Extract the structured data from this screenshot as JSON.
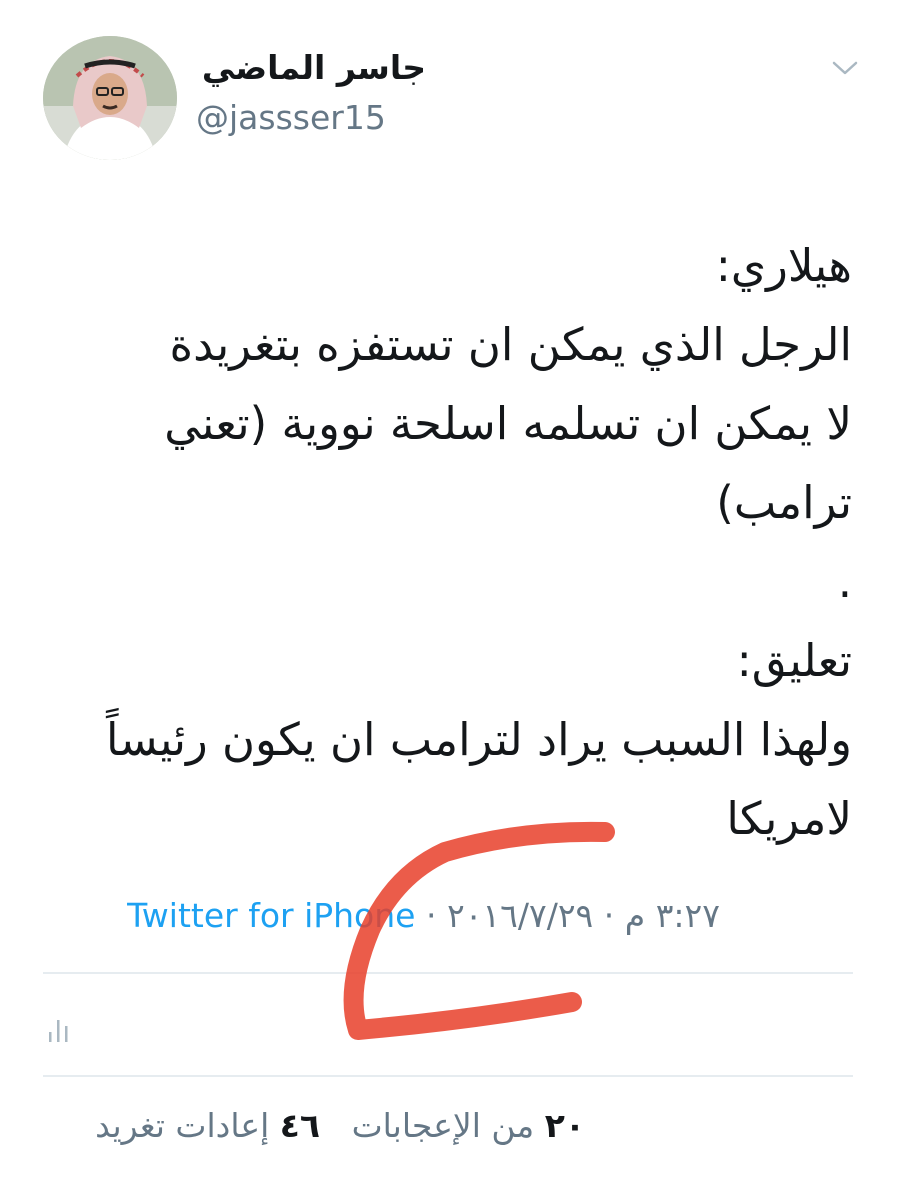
{
  "user": {
    "display_name": "جاسر الماضي",
    "handle": "@jassser15"
  },
  "tweet": {
    "text": "هيلاري:\nالرجل الذي يمكن ان تستفزه بتغريدة\nلا يمكن ان تسلمه اسلحة نووية (تعني\nترامب)\n.\nتعليق:\nولهذا السبب يراد لترامب ان يكون رئيساً\nلامريكا"
  },
  "meta": {
    "time": "٣:٢٧ م",
    "date": "٢٠١٦/٧/٢٩",
    "separator": "·",
    "source": "Twitter for iPhone"
  },
  "stats": {
    "retweets_count": "٤٦",
    "retweets_label": "إعادات تغريد",
    "likes_count": "٢٠",
    "likes_label": "من الإعجابات"
  },
  "icons": {
    "chevron": "chevron-down-icon",
    "analytics": "analytics-icon"
  },
  "colors": {
    "link": "#1da1f2",
    "secondary": "#657786",
    "scribble": "#e8402a"
  }
}
